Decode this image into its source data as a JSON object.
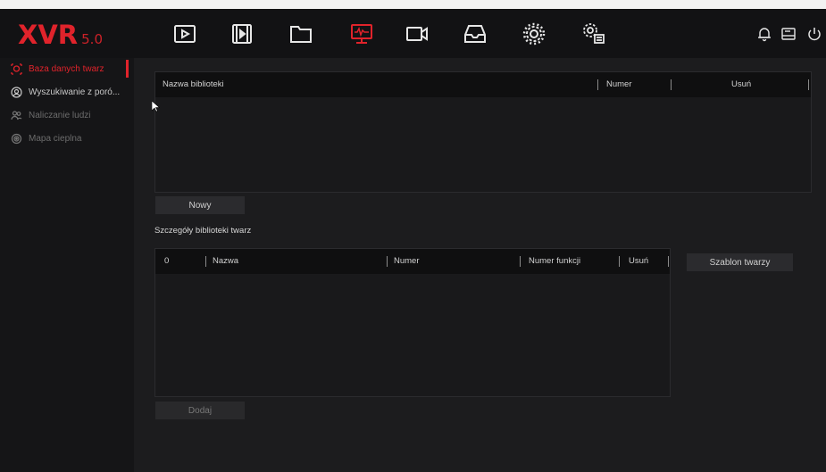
{
  "app": {
    "logo_text": "XVR",
    "version": "5.0"
  },
  "topbar": {
    "icons": [
      "playback-icon",
      "video-clip-icon",
      "folder-icon",
      "monitor-icon",
      "camera-icon",
      "storage-icon",
      "settings-gear-icon",
      "system-settings-icon"
    ],
    "active_icon": "monitor-icon",
    "right_icons": [
      "bell-icon",
      "disk-icon",
      "power-icon"
    ]
  },
  "sidebar": {
    "items": [
      {
        "label": "Baza danych twarz",
        "icon": "face-database-icon",
        "state": "active"
      },
      {
        "label": "Wyszukiwanie z poró...",
        "icon": "face-search-icon",
        "state": "normal"
      },
      {
        "label": "Naliczanie ludzi",
        "icon": "people-count-icon",
        "state": "disabled"
      },
      {
        "label": "Mapa cieplna",
        "icon": "heatmap-icon",
        "state": "disabled"
      }
    ]
  },
  "library_table": {
    "columns": [
      "Nazwa biblioteki",
      "Numer",
      "Usuń"
    ],
    "rows": []
  },
  "new_button": "Nowy",
  "details_heading": "Szczegóły biblioteki twarz",
  "details_table": {
    "columns": [
      "0",
      "Nazwa",
      "Numer",
      "Numer funkcji",
      "Usuń"
    ],
    "rows": []
  },
  "template_button": "Szablon twarzy",
  "add_button": "Dodaj",
  "colors": {
    "accent": "#e0232b",
    "background": "#1c1c1e",
    "topbar": "#121214",
    "sidebar": "#151517"
  }
}
